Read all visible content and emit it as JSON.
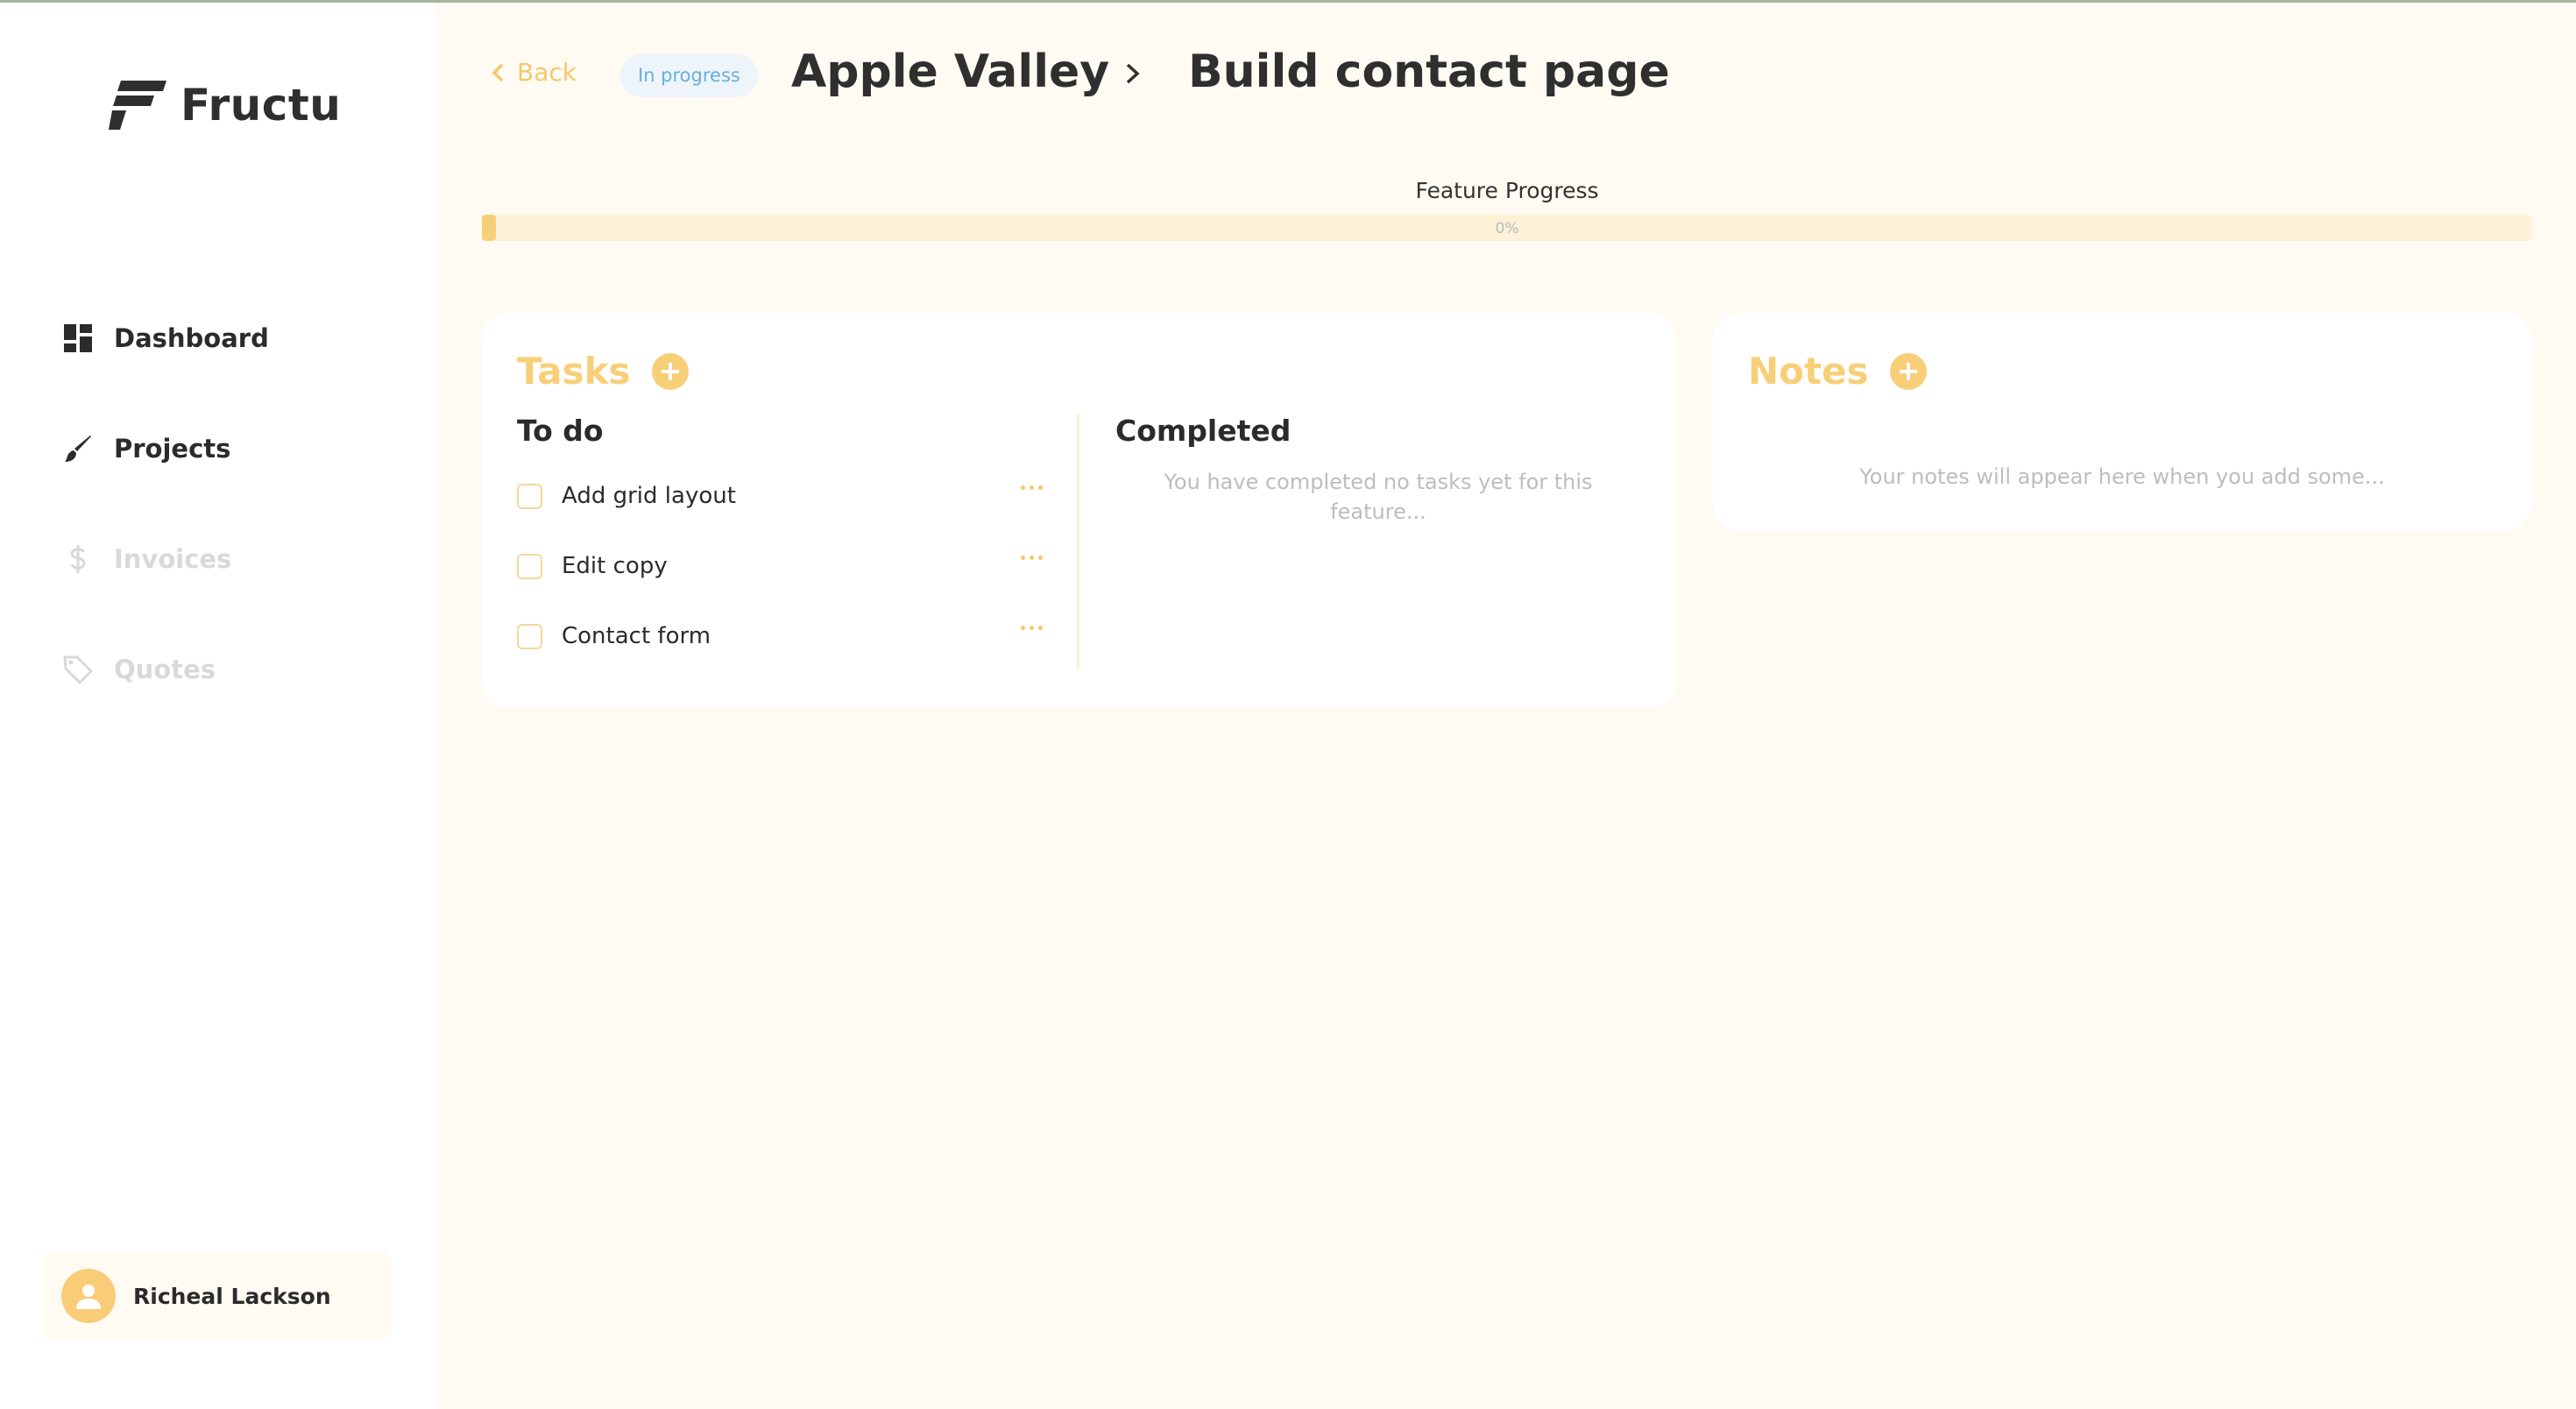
{
  "app": {
    "name": "Fructu"
  },
  "sidebar": {
    "items": [
      {
        "label": "Dashboard",
        "icon": "dashboard-icon",
        "state": "active"
      },
      {
        "label": "Projects",
        "icon": "brush-icon",
        "state": "active"
      },
      {
        "label": "Invoices",
        "icon": "dollar-icon",
        "state": "disabled"
      },
      {
        "label": "Quotes",
        "icon": "tag-icon",
        "state": "disabled"
      }
    ],
    "user": {
      "name": "Richeal Lackson",
      "icon": "user-icon"
    }
  },
  "header": {
    "back_label": "Back",
    "status_badge": "In progress",
    "project": "Apple Valley",
    "feature": "Build contact page"
  },
  "progress": {
    "title": "Feature Progress",
    "label": "0%",
    "value": 0
  },
  "tasks": {
    "title": "Tasks",
    "todo": {
      "heading": "To do",
      "items": [
        {
          "label": "Add grid layout",
          "checked": false
        },
        {
          "label": "Edit copy",
          "checked": false
        },
        {
          "label": "Contact form",
          "checked": false
        }
      ]
    },
    "completed": {
      "heading": "Completed",
      "empty_line1": "You have completed no tasks yet for this",
      "empty_line2": "feature..."
    }
  },
  "notes": {
    "title": "Notes",
    "empty": "Your notes will appear here when you add some..."
  },
  "colors": {
    "accent": "#f8cf79",
    "background": "#fffbf2",
    "badge_bg": "#edf5fb",
    "badge_text": "#6aaedc"
  }
}
